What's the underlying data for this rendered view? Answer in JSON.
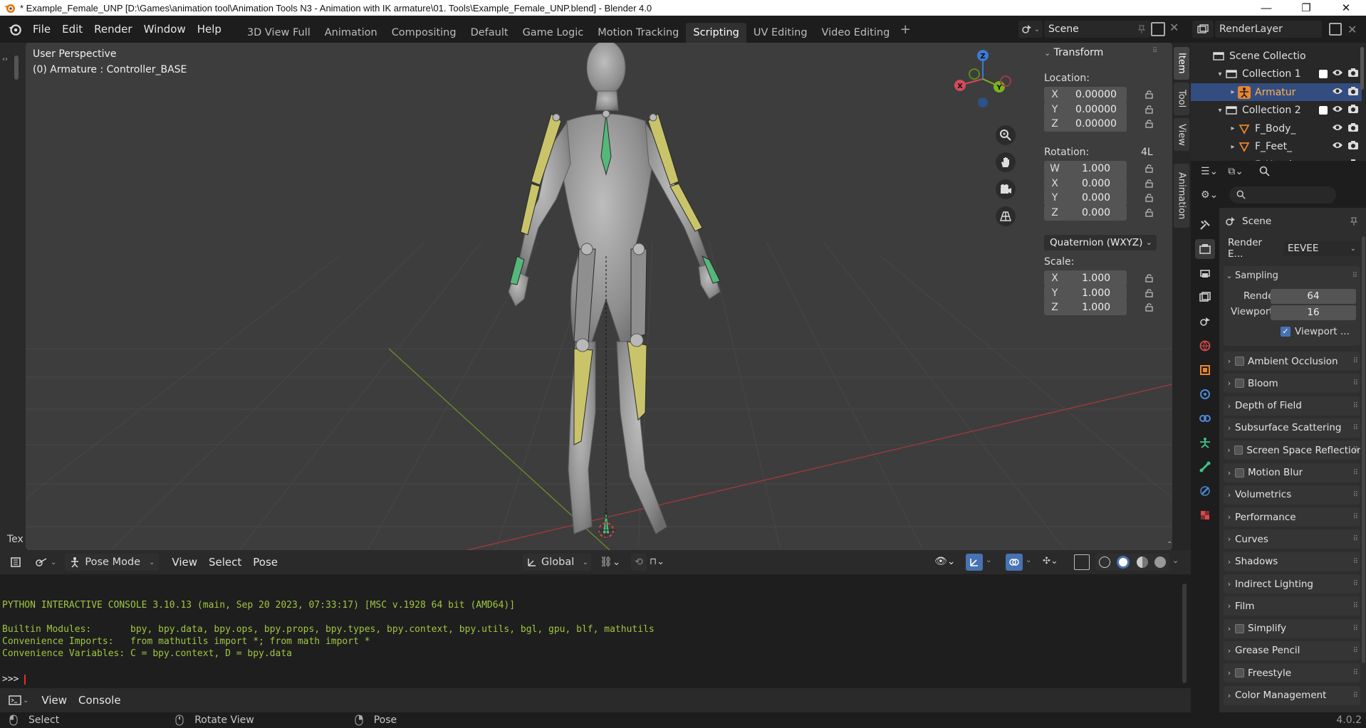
{
  "window": {
    "title": "* Example_Female_UNP [D:\\Games\\animation tool\\Animation Tools N3 - Animation with IK armature\\01. Tools\\Example_Female_UNP.blend] - Blender 4.0",
    "minimize": "—",
    "maximize": "❐",
    "close": "✕"
  },
  "menu": [
    "File",
    "Edit",
    "Render",
    "Window",
    "Help"
  ],
  "workspaces": [
    "3D View Full",
    "Animation",
    "Compositing",
    "Default",
    "Game Logic",
    "Motion Tracking",
    "Scripting",
    "UV Editing",
    "Video Editing"
  ],
  "active_workspace": "Scripting",
  "scene_name": "Scene",
  "view_layer": "RenderLayer",
  "viewport": {
    "perspective": "User Perspective",
    "object_info": "(0) Armature : Controller_BASE",
    "gizmo": {
      "x": "X",
      "y": "Y",
      "z": "Z"
    },
    "left_label": "Tex",
    "side_tabs": [
      "Item",
      "Tool",
      "View",
      "Animation"
    ],
    "active_side_tab": "Item"
  },
  "transform": {
    "title": "Transform",
    "location_label": "Location:",
    "location": [
      {
        "axis": "X",
        "value": "0.00000"
      },
      {
        "axis": "Y",
        "value": "0.00000"
      },
      {
        "axis": "Z",
        "value": "0.00000"
      }
    ],
    "rotation_label": "Rotation:",
    "rotation_extra": "4L",
    "rotation": [
      {
        "axis": "W",
        "value": "1.000"
      },
      {
        "axis": "X",
        "value": "0.000"
      },
      {
        "axis": "Y",
        "value": "0.000"
      },
      {
        "axis": "Z",
        "value": "0.000"
      }
    ],
    "rotation_mode": "Quaternion (WXYZ)",
    "scale_label": "Scale:",
    "scale": [
      {
        "axis": "X",
        "value": "1.000"
      },
      {
        "axis": "Y",
        "value": "1.000"
      },
      {
        "axis": "Z",
        "value": "1.000"
      }
    ]
  },
  "viewport_header": {
    "mode": "Pose Mode",
    "menus": [
      "View",
      "Select",
      "Pose"
    ],
    "orientation": "Global"
  },
  "console": {
    "lines": [
      "PYTHON INTERACTIVE CONSOLE 3.10.13 (main, Sep 20 2023, 07:33:17) [MSC v.1928 64 bit (AMD64)]",
      "",
      "Builtin Modules:       bpy, bpy.data, bpy.ops, bpy.props, bpy.types, bpy.context, bpy.utils, bgl, gpu, blf, mathutils",
      "Convenience Imports:   from mathutils import *; from math import *",
      "Convenience Variables: C = bpy.context, D = bpy.data"
    ],
    "prompt": ">>> ",
    "menus": [
      "View",
      "Console"
    ]
  },
  "status": {
    "select": "Select",
    "rotate": "Rotate View",
    "pose": "Pose",
    "version": "4.0.2"
  },
  "outliner": {
    "rows": [
      {
        "name": "Scene Collectio",
        "level": 0,
        "icon": "collection",
        "tri": ""
      },
      {
        "name": "Collection 1",
        "level": 1,
        "icon": "collection",
        "tri": "▾"
      },
      {
        "name": "Armatur",
        "level": 2,
        "icon": "armature",
        "tri": "▸",
        "selected": true
      },
      {
        "name": "Collection 2",
        "level": 1,
        "icon": "collection",
        "tri": "▾"
      },
      {
        "name": "F_Body_",
        "level": 2,
        "icon": "mesh",
        "tri": "▸"
      },
      {
        "name": "F_Feet_",
        "level": 2,
        "icon": "mesh",
        "tri": "▸"
      },
      {
        "name": "F_Hands",
        "level": 2,
        "icon": "mesh",
        "tri": "▸"
      }
    ]
  },
  "properties": {
    "context": "Scene",
    "render_engine_label": "Render E...",
    "render_engine": "EEVEE",
    "sampling": {
      "title": "Sampling",
      "render_label": "Render",
      "render": "64",
      "viewport_label": "Viewport",
      "viewport": "16",
      "viewport_denoise": "Viewport ..."
    },
    "panels": [
      {
        "label": "Ambient Occlusion",
        "checkbox": true
      },
      {
        "label": "Bloom",
        "checkbox": true
      },
      {
        "label": "Depth of Field",
        "checkbox": false
      },
      {
        "label": "Subsurface Scattering",
        "checkbox": false
      },
      {
        "label": "Screen Space Reflections",
        "checkbox": true
      },
      {
        "label": "Motion Blur",
        "checkbox": true
      },
      {
        "label": "Volumetrics",
        "checkbox": false
      },
      {
        "label": "Performance",
        "checkbox": false
      },
      {
        "label": "Curves",
        "checkbox": false
      },
      {
        "label": "Shadows",
        "checkbox": false
      },
      {
        "label": "Indirect Lighting",
        "checkbox": false
      },
      {
        "label": "Film",
        "checkbox": false
      },
      {
        "label": "Simplify",
        "checkbox": true
      },
      {
        "label": "Grease Pencil",
        "checkbox": false
      },
      {
        "label": "Freestyle",
        "checkbox": true
      },
      {
        "label": "Color Management",
        "checkbox": false
      }
    ]
  },
  "colors": {
    "accent": "#4772b3",
    "console_text": "#9ec640",
    "bone_yellow": "#c9c46a",
    "bone_green": "#55b77a",
    "selected_row": "#334d80"
  }
}
